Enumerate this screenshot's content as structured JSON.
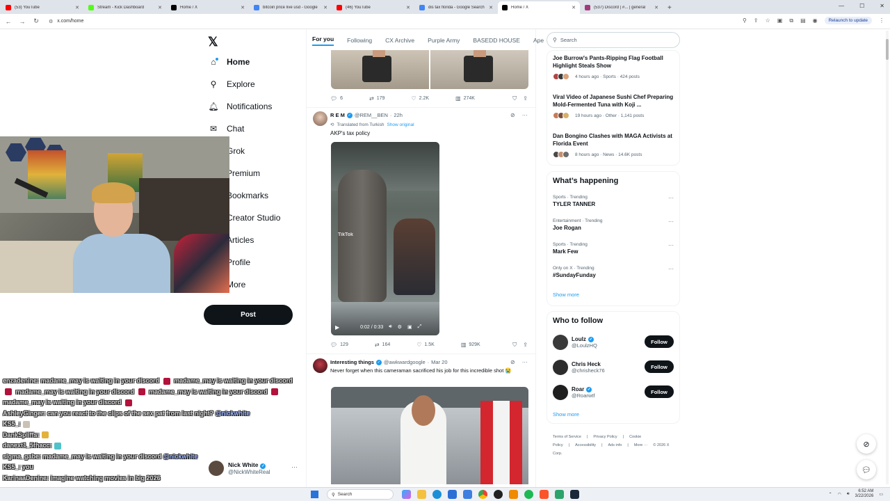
{
  "browser": {
    "tabs": [
      {
        "title": "(53) YouTube",
        "color": "#ff0000",
        "active": false
      },
      {
        "title": "Stream - Kick Dashboard",
        "color": "#53fc18",
        "active": false
      },
      {
        "title": "Home / X",
        "color": "#000000",
        "active": false
      },
      {
        "title": "bitcoin price live usd - Google",
        "color": "#4285f4",
        "active": false
      },
      {
        "title": "(46) YouTube",
        "color": "#ff0000",
        "active": false
      },
      {
        "title": "dis tax florida - Google Search",
        "color": "#4285f4",
        "active": false
      },
      {
        "title": "Home / X",
        "color": "#000000",
        "active": true
      },
      {
        "title": "(537) Discord | #...  | general",
        "color": "#a33b7a",
        "active": false
      }
    ],
    "url": "x.com/home",
    "relaunch_label": "Relaunch to update"
  },
  "x": {
    "logo": "𝕏",
    "nav": [
      {
        "label": "Home",
        "icon": "home-icon",
        "glyph": "⌂",
        "bold": true
      },
      {
        "label": "Explore",
        "icon": "search-icon",
        "glyph": "⚲",
        "bold": false
      },
      {
        "label": "Notifications",
        "icon": "bell-icon",
        "glyph": "🔔︎",
        "bold": false
      },
      {
        "label": "Chat",
        "icon": "mail-icon",
        "glyph": "✉",
        "bold": false
      },
      {
        "label": "Grok",
        "icon": "grok-icon",
        "glyph": "",
        "bold": false
      },
      {
        "label": "Premium",
        "icon": "premium-icon",
        "glyph": "",
        "bold": false
      },
      {
        "label": "Bookmarks",
        "icon": "bookmark-icon",
        "glyph": "",
        "bold": false
      },
      {
        "label": "Creator Studio",
        "icon": "creator-icon",
        "glyph": "",
        "bold": false
      },
      {
        "label": "Articles",
        "icon": "articles-icon",
        "glyph": "",
        "bold": false
      },
      {
        "label": "Profile",
        "icon": "profile-icon",
        "glyph": "",
        "bold": false
      },
      {
        "label": "More",
        "icon": "more-icon",
        "glyph": "",
        "bold": false
      }
    ],
    "post_label": "Post",
    "account": {
      "name": "Nick White",
      "handle": "@NickWhiteReal"
    }
  },
  "feed": {
    "tabs": [
      "For you",
      "Following",
      "CX Archive",
      "Purple Army",
      "BASEDD HOUSE",
      "Ape"
    ],
    "tweet0": {
      "replies": "6",
      "reposts": "179",
      "likes": "2.2K",
      "views": "274K"
    },
    "tweet1": {
      "name": "R E M",
      "handle": "@REM__BEN",
      "time": "22h",
      "translated": "Translated from Turkish",
      "show_original": "Show original",
      "text": "AKP's tax policy",
      "video_time": "0:02 / 0:33",
      "watermark": "TikTok",
      "replies": "129",
      "reposts": "164",
      "likes": "1.5K",
      "views": "929K"
    },
    "tweet2": {
      "name": "Interesting things",
      "handle": "@awkwardgoogle",
      "time": "Mar 20",
      "text": "Never forget when this cameraman sacrificed his job for this incredible shot 😭"
    }
  },
  "right": {
    "search_placeholder": "Search",
    "news": [
      {
        "headline": "Joe Burrow's Pants-Ripping Flag Football Highlight Steals Show",
        "meta": "4 hours ago · Sports · 424 posts"
      },
      {
        "headline": "Viral Video of Japanese Sushi Chef Preparing Mold-Fermented Tuna with Koji ...",
        "meta": "19 hours ago · Other · 1,141 posts"
      },
      {
        "headline": "Dan Bongino Clashes with MAGA Activists at Florida Event",
        "meta": "8 hours ago · News · 14.6K posts"
      }
    ],
    "happening_title": "What’s happening",
    "trends": [
      {
        "context": "Sports · Trending",
        "name": "TYLER TANNER"
      },
      {
        "context": "Entertainment · Trending",
        "name": "Joe Rogan"
      },
      {
        "context": "Sports · Trending",
        "name": "Mark Few"
      },
      {
        "context": "Only on X · Trending",
        "name": "#SundayFunday"
      }
    ],
    "show_more": "Show more",
    "wtf_title": "Who to follow",
    "who_to_follow": [
      {
        "name": "Loulz",
        "handle": "@LoulzHQ",
        "verified": true,
        "color": "#3a3a3a"
      },
      {
        "name": "Chris Heck",
        "handle": "@chrisheck76",
        "verified": false,
        "color": "#2d2d2d"
      },
      {
        "name": "Roar",
        "handle": "@Roarwtf",
        "verified": true,
        "color": "#1f1f1f"
      }
    ],
    "follow_label": "Follow",
    "footer": [
      "Terms of Service",
      "|",
      "Privacy Policy",
      "|",
      "Cookie Policy",
      "|",
      "Accessibility",
      "|",
      "Ads info",
      "|",
      "More ···",
      "© 2026 X Corp."
    ]
  },
  "chat": {
    "messages": [
      {
        "user": "enzadenine",
        "text": ": madame_may is waiting in your discord ",
        "tail": " madame_may is waiting in your discord ",
        "tail2": " madame_may is waiting in your discord ",
        "tail3": " madame_may is waiting in your discord ",
        "tail4": " madame_may is waiting in your discord "
      },
      {
        "user": "AshleyGinger",
        "text": ": can you react to the clips of the sex pat from last night? ",
        "mention": "@nickwhite"
      },
      {
        "user": "KS5_",
        "text": ":"
      },
      {
        "user": "DankSpliffs",
        "text": ":"
      },
      {
        "user": "danext1_5thacc",
        "text": ":"
      },
      {
        "user": "sigma_gabe",
        "text": ": madame_may is waiting in your discord ",
        "mention": "@nickwhite"
      },
      {
        "user": "KS5_",
        "text": ": you"
      },
      {
        "user": "KarinaaDenine",
        "text": ": imagine watching movies in big 2026"
      }
    ]
  },
  "taskbar": {
    "search_label": "Search",
    "time": "6:52 AM",
    "date": "3/22/2026"
  }
}
